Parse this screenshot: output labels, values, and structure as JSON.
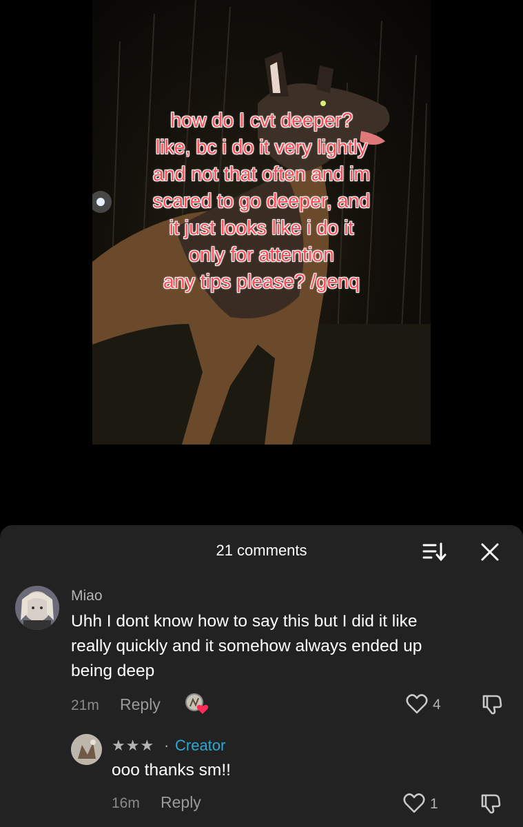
{
  "video": {
    "overlay_lines": [
      "how do I cvt deeper?",
      "like, bc i do it very lightly",
      "and not that often and im",
      "scared to go deeper, and",
      "it just looks like i do it",
      "only for attention",
      "any tips please? /genq"
    ]
  },
  "comments_panel": {
    "count_label": "21 comments",
    "icons": {
      "sort": "sort-icon",
      "close": "close-icon"
    }
  },
  "comments": [
    {
      "username": "Miao",
      "text": "Uhh I dont know how to say this but I did it like really quickly and it somehow always ended up being deep",
      "lines": [
        "Uhh I dont know how to say this but I did it like",
        "really quickly and it somehow always ended up",
        "being deep"
      ],
      "time": "21m",
      "reply_label": "Reply",
      "likes": "4",
      "creator_liked": true
    },
    {
      "username": "★★★",
      "separator": "·",
      "badge": "Creator",
      "text": "ooo thanks sm!!",
      "time": "16m",
      "reply_label": "Reply",
      "likes": "1"
    }
  ],
  "colors": {
    "overlay_text": "#ff4d57",
    "sheet_bg": "#222222",
    "creator_badge": "#2aa8d6",
    "heart": "#ff2d55"
  }
}
